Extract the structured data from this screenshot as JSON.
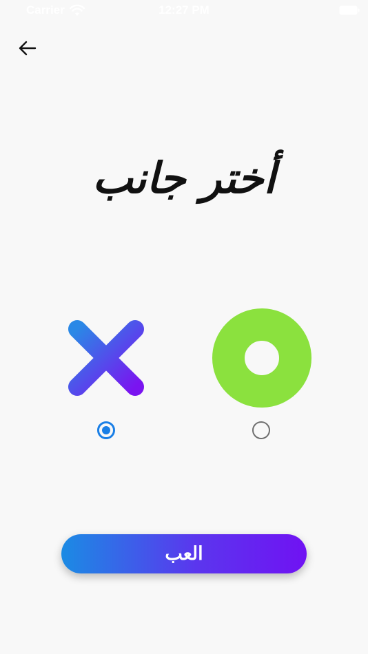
{
  "status_bar": {
    "carrier": "Carrier",
    "time": "12:27 PM"
  },
  "header": {
    "back_icon": "arrow-left-icon"
  },
  "title": "أختر جانب",
  "sides": [
    {
      "symbol": "X",
      "icon": "x-mark-icon",
      "selected": true
    },
    {
      "symbol": "O",
      "icon": "ring-icon",
      "selected": false
    }
  ],
  "play_button": {
    "label": "العب"
  },
  "colors": {
    "background": "#f8f8f8",
    "x_gradient_start": "#2a88e6",
    "x_gradient_end": "#7a14f0",
    "o_color": "#8be13e",
    "radio_selected": "#1a7fe6",
    "radio_unselected": "#6f6f6f",
    "button_gradient_start": "#1b8be4",
    "button_gradient_end": "#7012f3"
  }
}
